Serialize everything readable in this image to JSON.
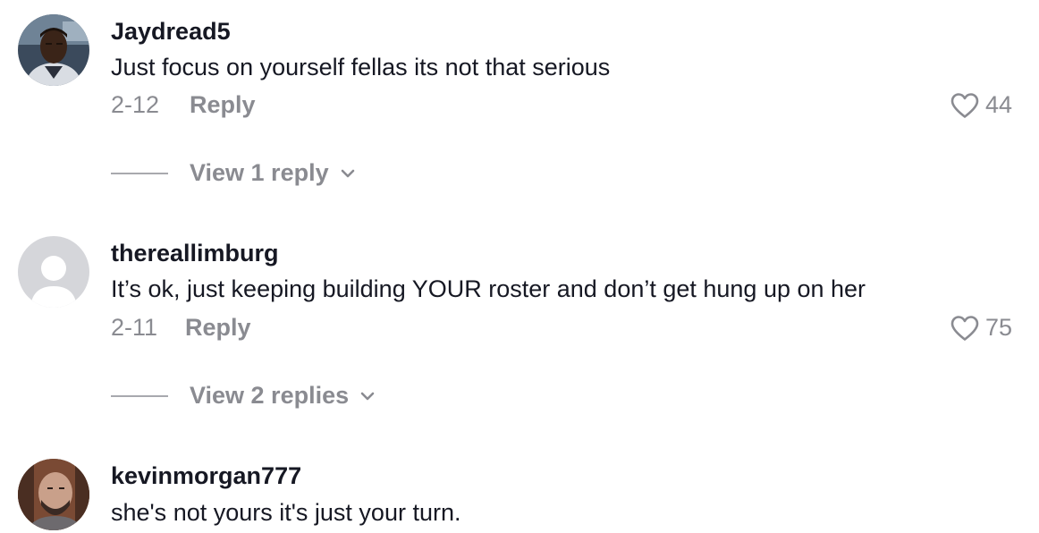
{
  "comments": [
    {
      "username": "Jaydread5",
      "text": "Just focus on yourself fellas its not that serious",
      "date": "2-12",
      "reply_label": "Reply",
      "likes": "44",
      "view_replies": "View 1 reply",
      "avatar": "user-photo"
    },
    {
      "username": "thereallimburg",
      "text": "It’s ok, just keeping building YOUR roster and don’t get hung up on her",
      "date": "2-11",
      "reply_label": "Reply",
      "likes": "75",
      "view_replies": "View 2 replies",
      "avatar": "default-avatar"
    },
    {
      "username": "kevinmorgan777",
      "text": "she's not yours it's just your turn.",
      "avatar": "user-photo"
    }
  ],
  "icons": {
    "like": "heart-outline-icon",
    "expand": "chevron-down-icon"
  },
  "colors": {
    "primary_text": "#161823",
    "secondary_text": "#8a8b91",
    "background": "#ffffff"
  }
}
